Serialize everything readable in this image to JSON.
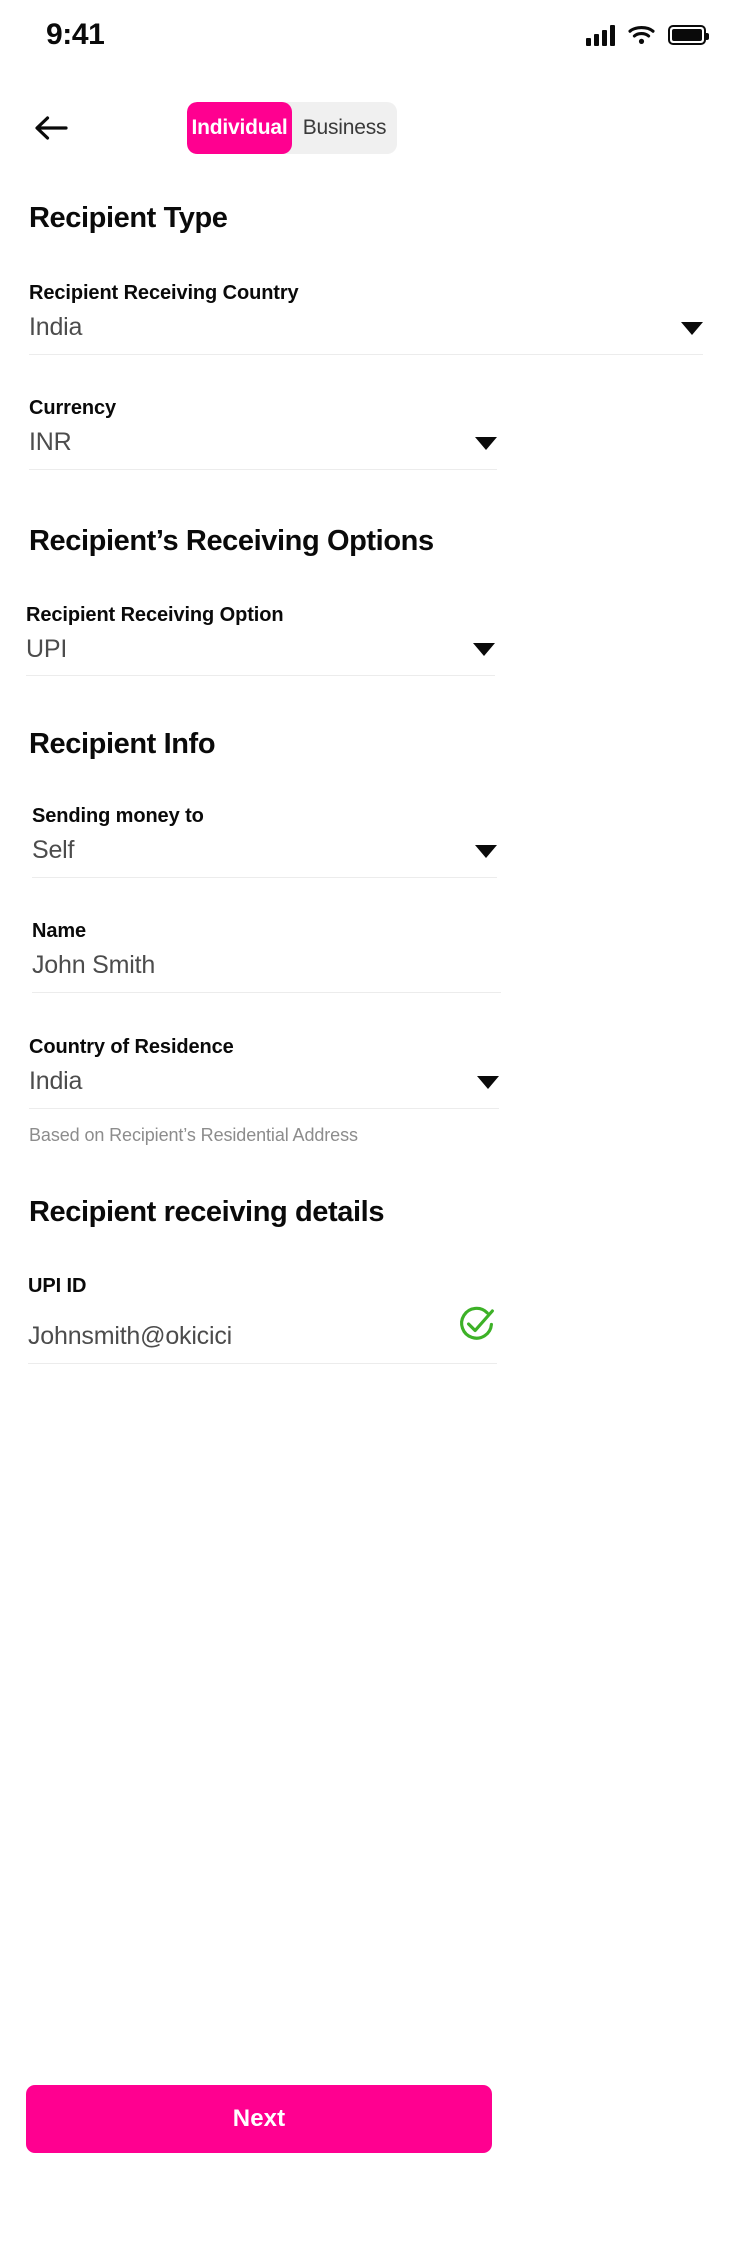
{
  "status_bar": {
    "time": "9:41",
    "signal_icon": "cellular-signal-icon",
    "wifi_icon": "wifi-icon",
    "battery_icon": "battery-full-icon"
  },
  "header": {
    "back_icon": "back-arrow-icon",
    "tabs": [
      {
        "label": "Individual",
        "active": true
      },
      {
        "label": "Business",
        "active": false
      }
    ]
  },
  "sections": {
    "recipient_type": {
      "title": "Recipient Type",
      "country": {
        "label": "Recipient Receiving Country",
        "value": "India",
        "caret_icon": "chevron-down-icon"
      },
      "currency": {
        "label": "Currency",
        "value": "INR",
        "caret_icon": "chevron-down-icon"
      }
    },
    "receiving_options": {
      "title": "Recipient’s Receiving Options",
      "option": {
        "label": "Recipient Receiving Option",
        "value": "UPI",
        "caret_icon": "chevron-down-icon"
      }
    },
    "recipient_info": {
      "title": "Recipient Info",
      "sending_money_to": {
        "label": "Sending money to",
        "value": "Self",
        "caret_icon": "chevron-down-icon"
      },
      "name": {
        "label": "Name",
        "value": "John Smith"
      },
      "country_of_residence": {
        "label": "Country of Residence",
        "value": "India",
        "caret_icon": "chevron-down-icon",
        "helper": "Based on Recipient’s Residential Address"
      }
    },
    "receiving_details": {
      "title": "Recipient receiving details",
      "upi_id": {
        "label": "UPI ID",
        "value": "Johnsmith@okicici",
        "status_icon": "verified-check-circle-icon"
      }
    }
  },
  "footer": {
    "next_label": "Next"
  },
  "colors": {
    "brand_pink": "#FF0090",
    "verified_green": "#3DB127",
    "divider": "#ECECEC",
    "value_text": "#4C4C4C",
    "helper_text": "#8C8C8C"
  }
}
